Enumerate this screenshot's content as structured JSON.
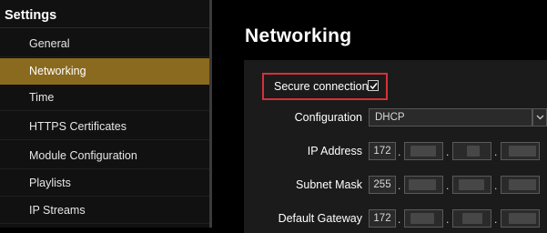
{
  "sidebar": {
    "title": "Settings",
    "items": [
      {
        "label": "General"
      },
      {
        "label": "Networking"
      },
      {
        "label": "Time"
      },
      {
        "label": "HTTPS Certificates"
      },
      {
        "label": "Module Configuration"
      },
      {
        "label": "Playlists"
      },
      {
        "label": "IP Streams"
      }
    ],
    "active_index": 1
  },
  "main": {
    "title": "Networking",
    "secure_connection": {
      "label": "Secure connection",
      "checked": true
    },
    "configuration": {
      "label": "Configuration",
      "value": "DHCP"
    },
    "ip_address": {
      "label": "IP Address",
      "first_octet": "172"
    },
    "subnet_mask": {
      "label": "Subnet Mask",
      "first_octet": "255"
    },
    "default_gateway": {
      "label": "Default Gateway",
      "first_octet": "172"
    },
    "octet_separator": "."
  },
  "colors": {
    "active_item": "#8a6a1f",
    "highlight_box": "#d6303a",
    "panel": "#1b1b1b",
    "sidebar": "#111111"
  }
}
